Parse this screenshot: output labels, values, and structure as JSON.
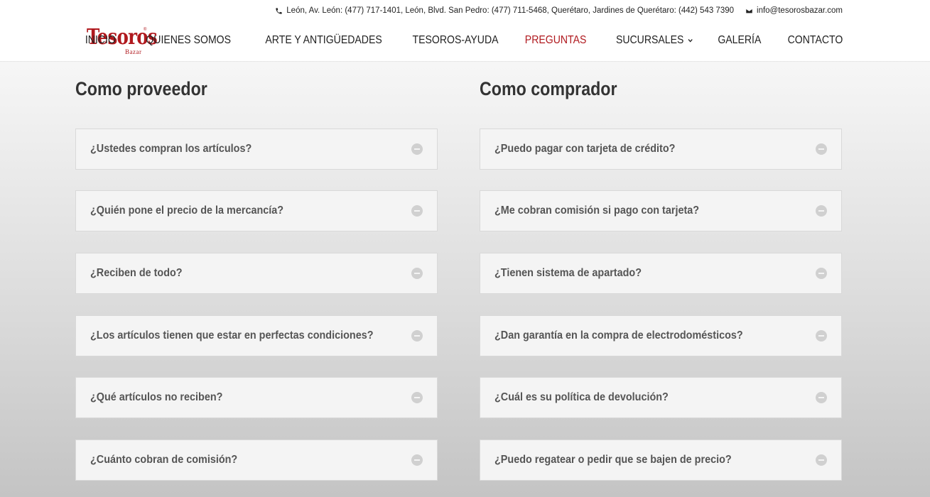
{
  "topbar": {
    "phone_text": "León, Av. León: (477) 717-1401, León, Blvd. San Pedro: (477) 711-5468, Querétaro, Jardines de Querétaro: (442) 543 7390",
    "email_text": "info@tesorosbazar.com"
  },
  "logo": {
    "main": "Tesoros",
    "sub": "Bazar",
    "reg": "®"
  },
  "nav": {
    "items": [
      {
        "label": "INICIO"
      },
      {
        "label": "QUIENES SOMOS"
      },
      {
        "label": "ARTE Y ANTIGÜEDADES"
      },
      {
        "label": "TESOROS-AYUDA"
      },
      {
        "label": "PREGUNTAS"
      },
      {
        "label": "SUCURSALES"
      },
      {
        "label": "GALERÍA"
      },
      {
        "label": "CONTACTO"
      }
    ],
    "active_color": "#b0191e"
  },
  "proveedor": {
    "title": "Como proveedor",
    "questions": [
      "¿Ustedes compran los artículos?",
      "¿Quién pone el precio de la mercancía?",
      "¿Reciben de todo?",
      "¿Los artículos tienen que estar en perfectas condiciones?",
      "¿Qué artículos no reciben?",
      "¿Cuánto cobran de comisión?"
    ]
  },
  "comprador": {
    "title": "Como comprador",
    "questions": [
      "¿Puedo pagar con tarjeta de crédito?",
      "¿Me cobran comisión si pago con tarjeta?",
      "¿Tienen sistema de apartado?",
      "¿Dan garantía en la compra de electrodomésticos?",
      "¿Cuál es su política de devolución?",
      "¿Puedo regatear o pedir que se bajen de precio?"
    ]
  }
}
